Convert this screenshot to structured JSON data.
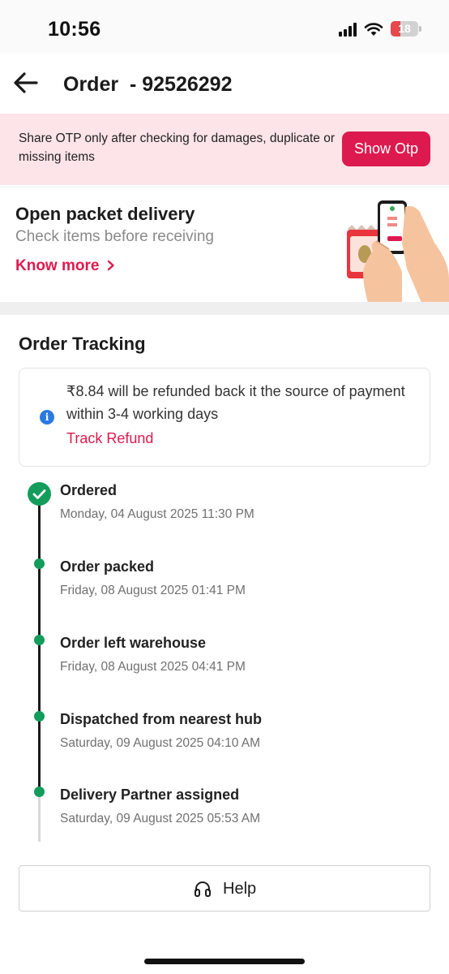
{
  "status_bar": {
    "time": "10:56",
    "battery": "18",
    "battery_color": "#e5484d"
  },
  "header": {
    "title": "Order  - 92526292"
  },
  "otp_banner": {
    "message": "Share OTP only after checking for damages, duplicate or missing items",
    "button_label": "Show Otp"
  },
  "packet_card": {
    "title": "Open packet delivery",
    "subtitle": "Check items before receiving",
    "link_label": "Know more"
  },
  "tracking": {
    "title": "Order Tracking",
    "refund_message": "₹8.84 will be refunded back it the source of payment within 3-4 working days",
    "refund_link": "Track Refund",
    "steps": [
      {
        "title": "Ordered",
        "date": "Monday, 04 August 2025 11:30 PM"
      },
      {
        "title": "Order packed",
        "date": "Friday, 08 August 2025 01:41 PM"
      },
      {
        "title": "Order left warehouse",
        "date": "Friday, 08 August 2025 04:41 PM"
      },
      {
        "title": "Dispatched from nearest hub",
        "date": "Saturday, 09 August 2025 04:10 AM"
      },
      {
        "title": "Delivery Partner assigned",
        "date": "Saturday, 09 August 2025 05:53 AM"
      }
    ]
  },
  "help": {
    "label": "Help"
  },
  "colors": {
    "accent": "#dd1a4f",
    "success": "#139c5b",
    "banner_bg": "#fce4e8",
    "info": "#2a7ae2"
  }
}
